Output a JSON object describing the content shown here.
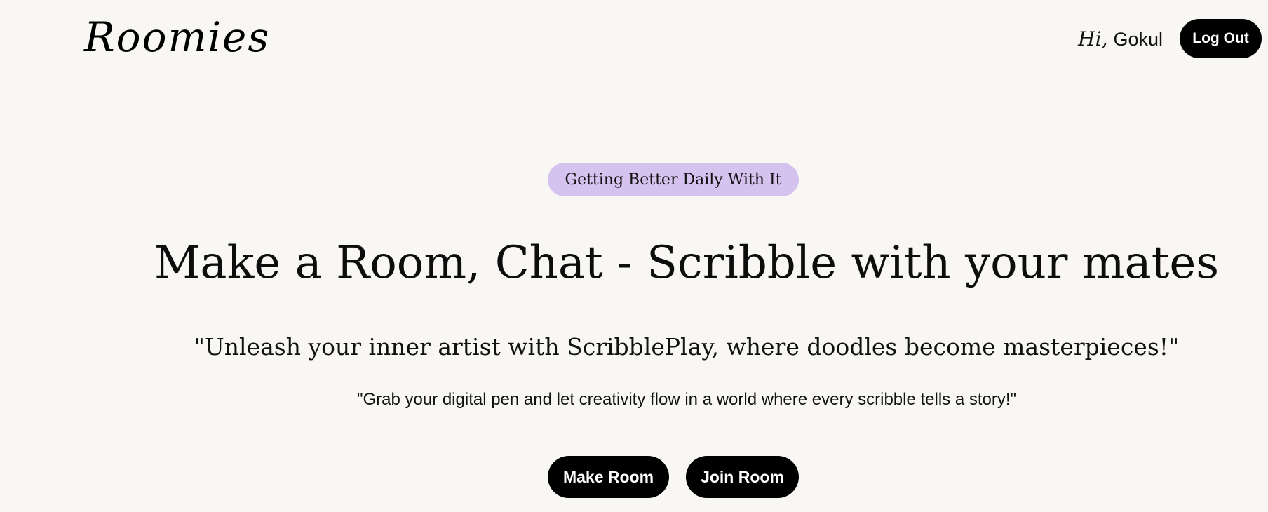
{
  "header": {
    "logo_text": "Roomies",
    "greeting_prefix": "Hi,",
    "user_name": "Gokul",
    "logout_label": "Log Out"
  },
  "hero": {
    "badge_text": "Getting Better Daily With It",
    "headline": "Make a Room, Chat - Scribble with your mates",
    "subheadline": "\"Unleash your inner artist with ScribblePlay, where doodles become masterpieces!\"",
    "tagline": "\"Grab your digital pen and let creativity flow in a world where every scribble tells a story!\"",
    "make_room_label": "Make Room",
    "join_room_label": "Join Room"
  },
  "colors": {
    "background": "#f8f7f3",
    "badge_bg": "#d6c2ef",
    "button_bg": "#000000",
    "button_text": "#ffffff"
  }
}
